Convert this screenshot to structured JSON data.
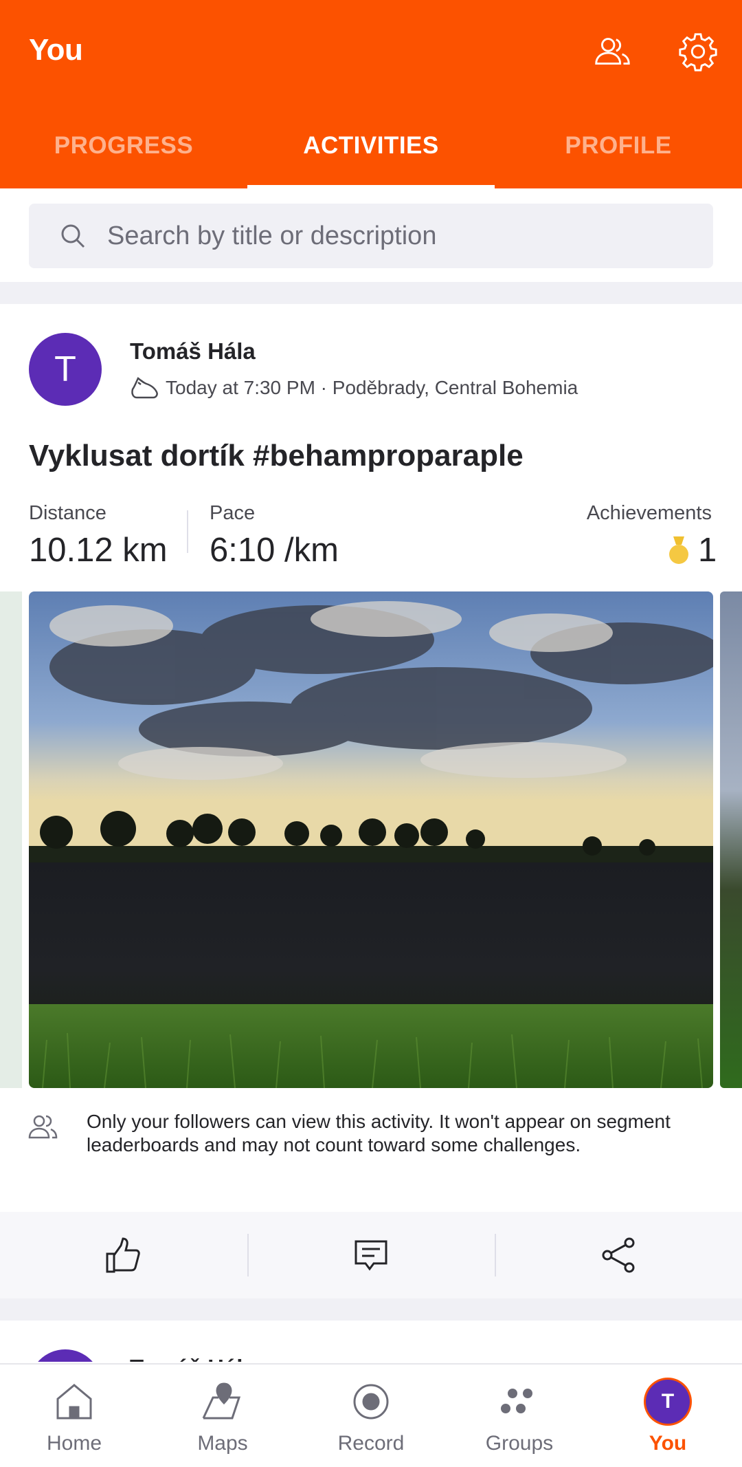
{
  "header": {
    "title": "You",
    "icons": [
      "friends-icon",
      "settings-gear-icon"
    ],
    "tabs": [
      {
        "label": "PROGRESS",
        "active": false
      },
      {
        "label": "ACTIVITIES",
        "active": true
      },
      {
        "label": "PROFILE",
        "active": false
      }
    ],
    "accent_color": "#fc5200"
  },
  "search": {
    "placeholder": "Search by title or description",
    "value": ""
  },
  "activity": {
    "avatar_initial": "T",
    "avatar_color": "#5c2cb5",
    "athlete_name": "Tomáš Hála",
    "meta": "Today at 7:30 PM · Poděbrady, Central Bohemia",
    "sport_icon": "run-shoe-icon",
    "title": "Vyklusat dortík #behamproparaple",
    "stats": {
      "distance_label": "Distance",
      "distance_value": "10.12 km",
      "pace_label": "Pace",
      "pace_value": "6:10 /km",
      "achievements_label": "Achievements",
      "achievements_value": "1"
    },
    "privacy_note": "Only your followers can view this activity. It won't appear on segment leaderboards and may not count toward some challenges.",
    "actions": [
      "kudos-thumbs-up-icon",
      "comment-icon",
      "share-icon"
    ]
  },
  "next_activity": {
    "athlete_name": "Tomáš Hála"
  },
  "bottom_nav": [
    {
      "label": "Home",
      "icon": "home-icon",
      "active": false
    },
    {
      "label": "Maps",
      "icon": "maps-icon",
      "active": false
    },
    {
      "label": "Record",
      "icon": "record-icon",
      "active": false
    },
    {
      "label": "Groups",
      "icon": "groups-icon",
      "active": false
    },
    {
      "label": "You",
      "icon": "avatar",
      "avatar_initial": "T",
      "active": true
    }
  ]
}
